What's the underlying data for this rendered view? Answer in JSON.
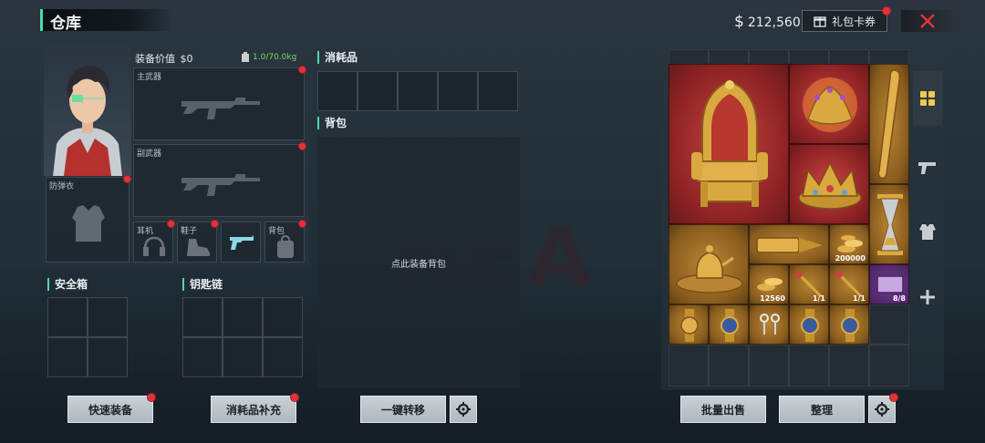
{
  "header": {
    "title": "仓库",
    "currency_symbol": "$",
    "balance": "212,560",
    "coupon_label": "礼包卡券"
  },
  "equipment": {
    "value_label": "装备价值",
    "value": "$0",
    "weight": "1.0/70.0kg",
    "slots": {
      "primary": "主武器",
      "secondary": "副武器",
      "armor": "防弹衣",
      "headset": "耳机",
      "shoes": "鞋子",
      "backpack": "背包"
    }
  },
  "consumables": {
    "label": "消耗品"
  },
  "backpack": {
    "label": "背包",
    "hint": "点此装备背包"
  },
  "safe_box": {
    "label": "安全箱"
  },
  "keychain": {
    "label": "钥匙链"
  },
  "buttons": {
    "quick_equip": "快速装备",
    "refill": "消耗品补充",
    "transfer_all": "一键转移",
    "bulk_sell": "批量出售",
    "organize": "整理"
  },
  "inventory": {
    "items": [
      {
        "name": "golden-throne",
        "rarity": "red"
      },
      {
        "name": "gem-crown-ornament",
        "rarity": "red"
      },
      {
        "name": "golden-crown",
        "rarity": "red"
      },
      {
        "name": "golden-bat",
        "rarity": "gold"
      },
      {
        "name": "hourglass",
        "rarity": "gold"
      },
      {
        "name": "golden-tea-set",
        "rarity": "gold"
      },
      {
        "name": "golden-drill",
        "rarity": "gold"
      },
      {
        "name": "gold-coins-a",
        "rarity": "gold",
        "qty": "200000"
      },
      {
        "name": "gold-coins-b",
        "rarity": "gold",
        "qty": "12560"
      },
      {
        "name": "key-a",
        "rarity": "gold",
        "qty": "1/1"
      },
      {
        "name": "key-b",
        "rarity": "gold",
        "qty": "1/1"
      },
      {
        "name": "card-item",
        "rarity": "purple",
        "qty": "8/8"
      },
      {
        "name": "watch-a",
        "rarity": "gold"
      },
      {
        "name": "watch-b",
        "rarity": "gold"
      },
      {
        "name": "earrings",
        "rarity": "gold"
      },
      {
        "name": "watch-c",
        "rarity": "gold"
      },
      {
        "name": "watch-d",
        "rarity": "gold"
      }
    ]
  },
  "colors": {
    "accent": "#4ed9a9",
    "red_rarity": "#9a2a2b",
    "gold_rarity": "#a67427",
    "purple_rarity": "#5a2d76",
    "notify": "#e0343a"
  },
  "side_tabs": [
    "grid-icon",
    "pistol-icon",
    "armor-icon",
    "plus-icon"
  ]
}
